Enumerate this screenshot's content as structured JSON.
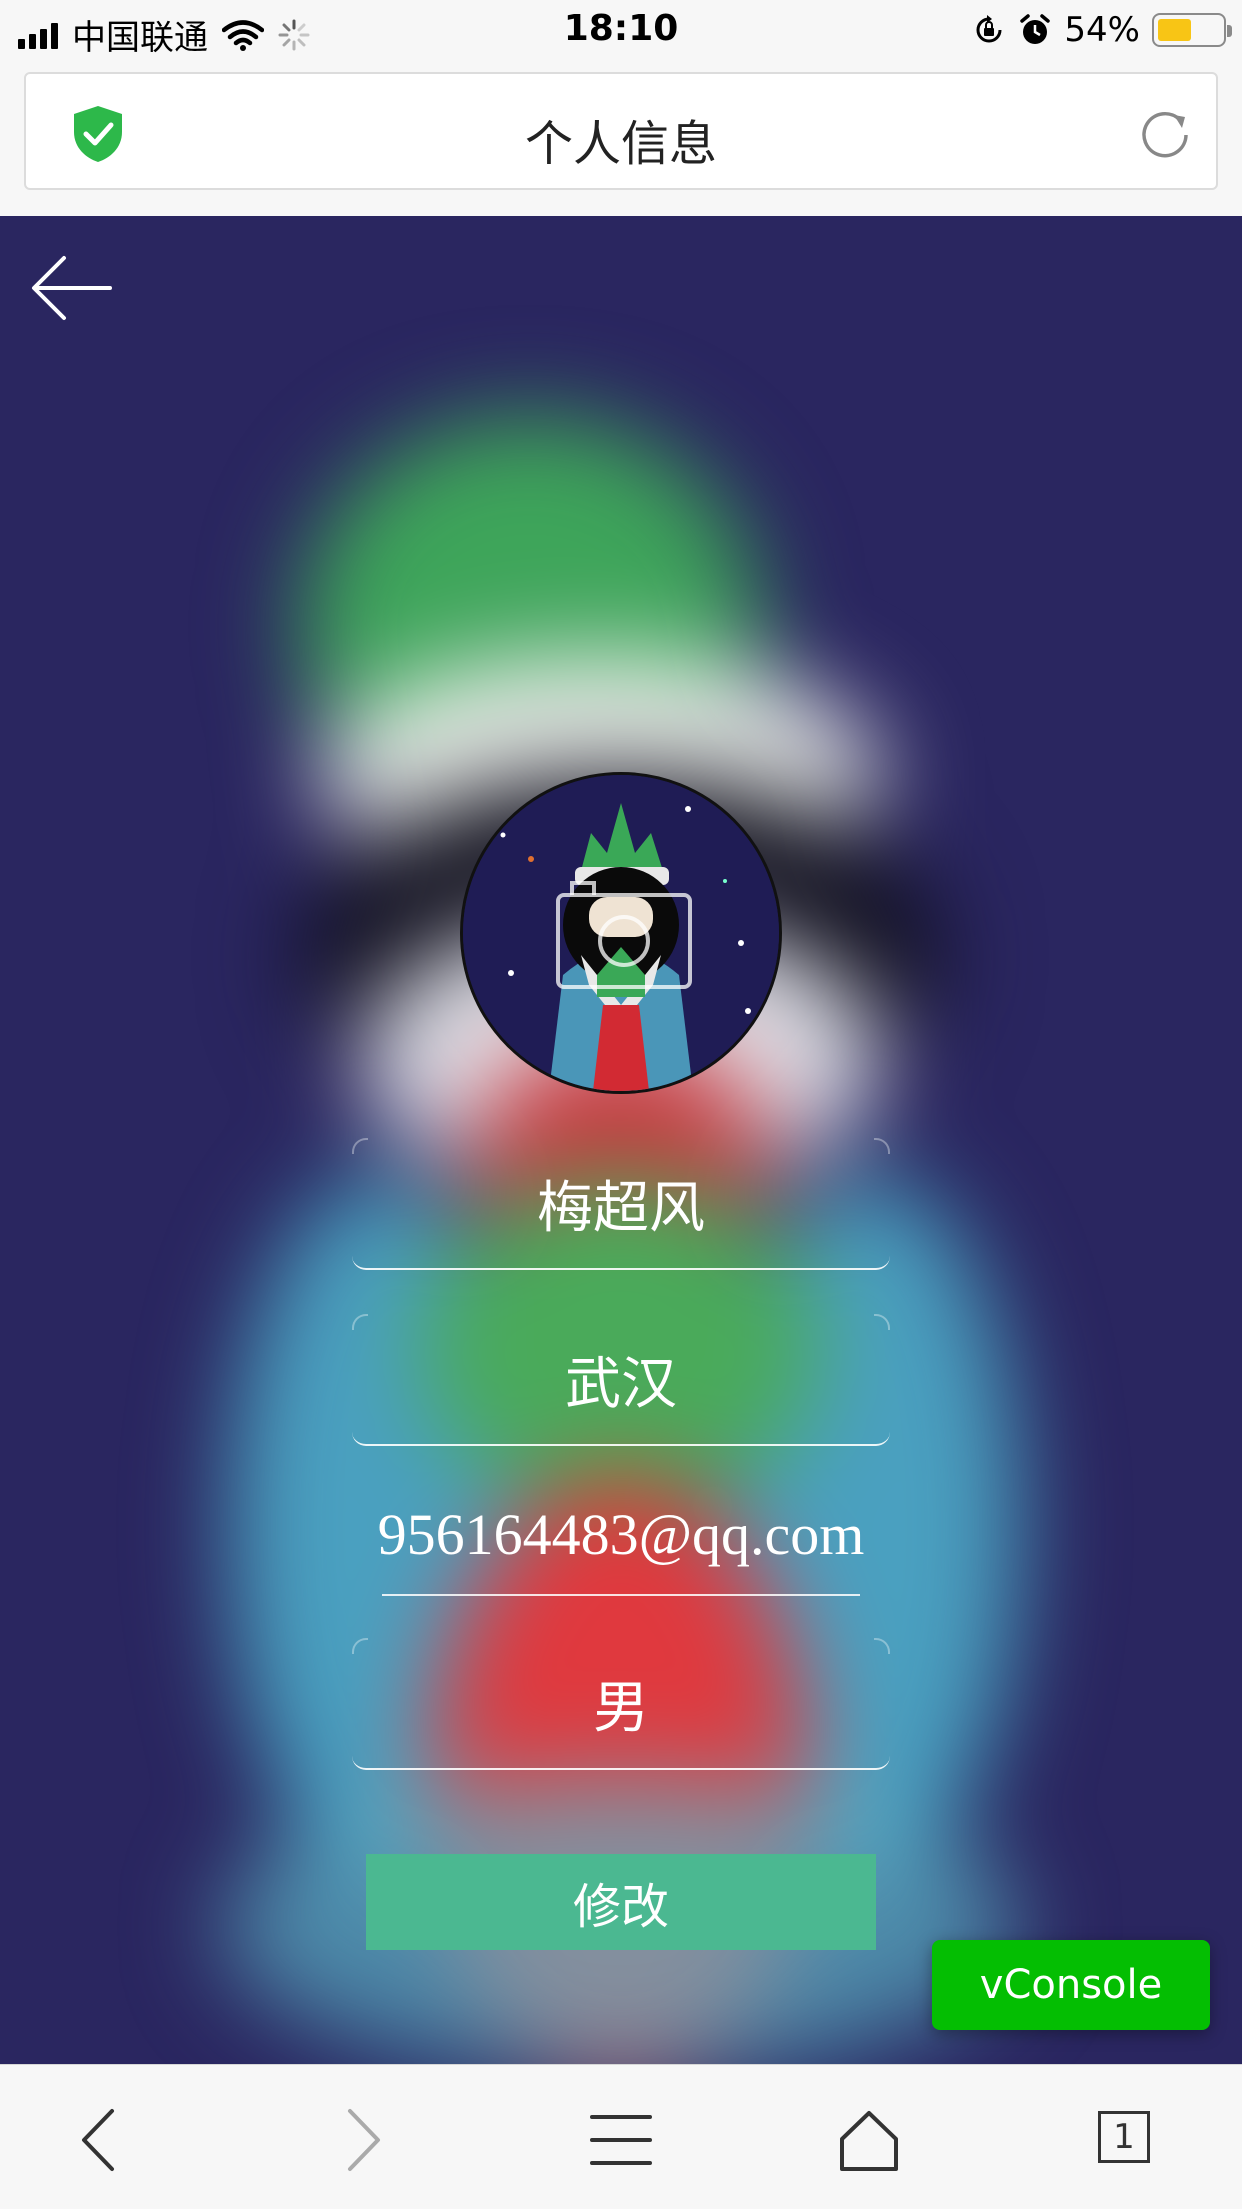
{
  "status_bar": {
    "carrier": "中国联通",
    "time": "18:10",
    "battery_percent": "54%",
    "battery_level": 0.54,
    "battery_color": "#f8c515"
  },
  "address_bar": {
    "title": "个人信息",
    "secure_icon": "shield-check-icon",
    "reload_icon": "reload-icon"
  },
  "profile": {
    "name": "梅超风",
    "city": "武汉",
    "email": "956164483@qq.com",
    "gender": "男",
    "submit_label": "修改",
    "avatar_icon": "camera-icon"
  },
  "vconsole": {
    "label": "vConsole"
  },
  "toolbar": {
    "tab_count": "1",
    "items": [
      "back-icon",
      "forward-icon",
      "menu-icon",
      "home-icon",
      "tabs-icon"
    ]
  },
  "colors": {
    "background": "#2a2660",
    "button": "#4bb891",
    "vconsole": "#04be02",
    "shield": "#2db84a"
  }
}
